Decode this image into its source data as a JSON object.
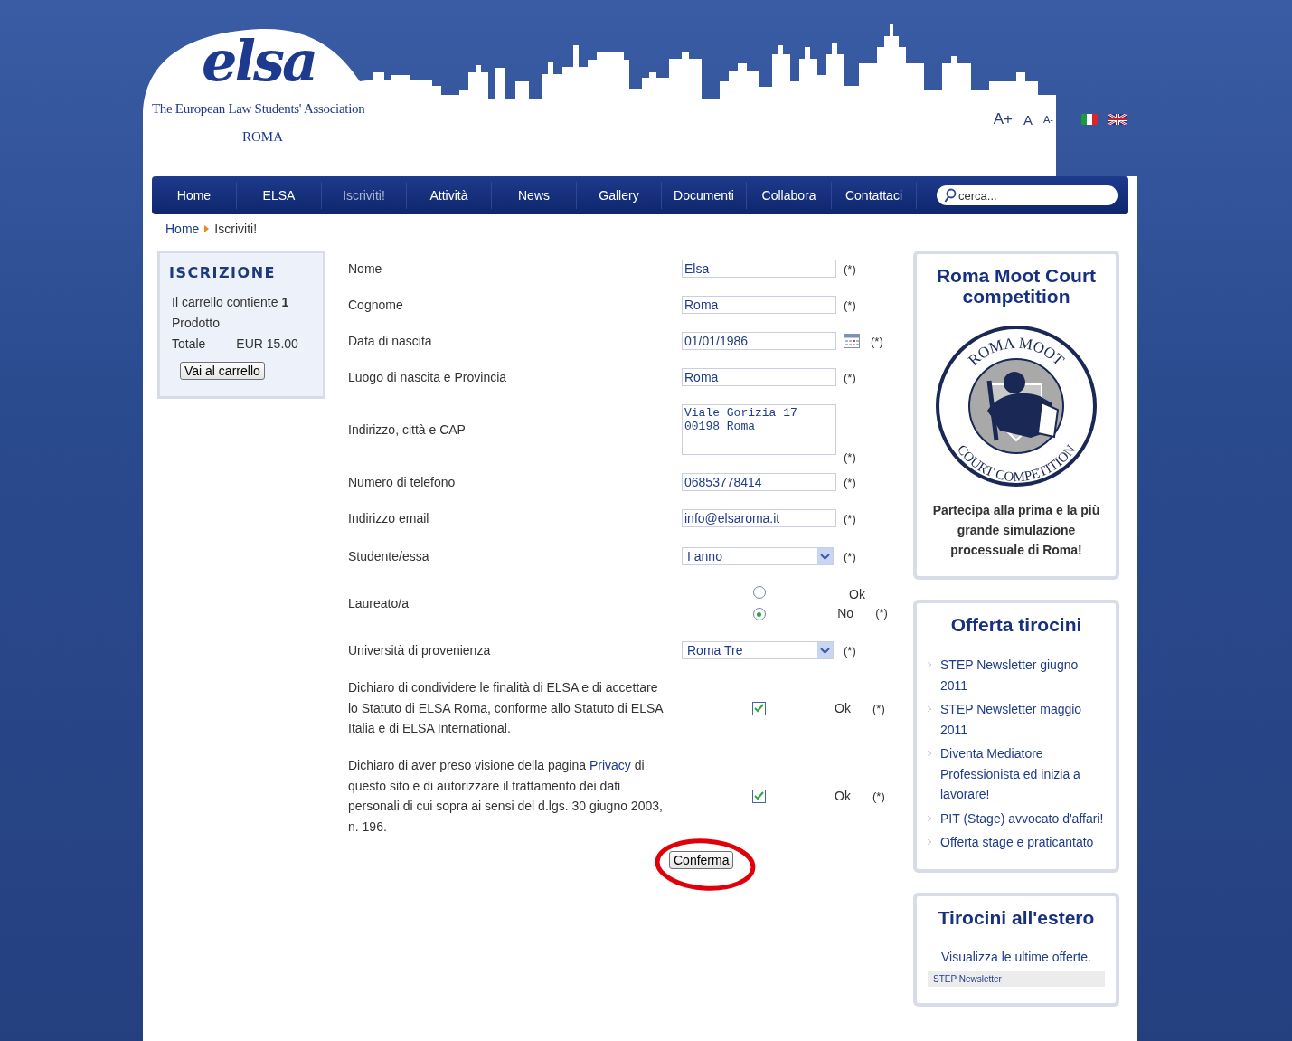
{
  "header": {
    "logo": "elsa",
    "tagline": "The European Law Students' Association",
    "city": "ROMA",
    "font_sizes": [
      "A+",
      "A",
      "A-"
    ]
  },
  "nav": {
    "items": [
      {
        "label": "Home",
        "selected": false
      },
      {
        "label": "ELSA",
        "selected": false
      },
      {
        "label": "Iscriviti!",
        "selected": true
      },
      {
        "label": "Attività",
        "selected": false
      },
      {
        "label": "News",
        "selected": false
      },
      {
        "label": "Gallery",
        "selected": false
      },
      {
        "label": "Documenti",
        "selected": false
      },
      {
        "label": "Collabora",
        "selected": false
      },
      {
        "label": "Contattaci",
        "selected": false
      }
    ],
    "search": {
      "placeholder": "cerca..."
    }
  },
  "breadcrumb": [
    "Home",
    "Iscriviti!"
  ],
  "cart": {
    "title": "ISCRIZIONE",
    "summary": "Il carrello contiente **1** Prodotto",
    "total_label": "Totale",
    "total_value": "EUR 15.00",
    "button": "Vai al carrello"
  },
  "form": {
    "rows": [
      {
        "kind": "text",
        "label": "Nome",
        "value": "Elsa",
        "required": "(*)"
      },
      {
        "kind": "text",
        "label": "Cognome",
        "value": "Roma",
        "required": "(*)"
      },
      {
        "kind": "date",
        "label": "Data di nascita",
        "value": "01/01/1986",
        "required": "(*)"
      },
      {
        "kind": "text",
        "label": "Luogo di nascita e Provincia",
        "value": "Roma",
        "required": "(*)"
      },
      {
        "kind": "textarea",
        "label": "Indirizzo, città e CAP",
        "value": "Viale Gorizia 17\n00198 Roma",
        "required": "(*)"
      },
      {
        "kind": "text",
        "label": "Numero di telefono",
        "value": "06853778414",
        "required": "(*)"
      },
      {
        "kind": "text",
        "label": "Indirizzo email",
        "value": "info@elsaroma.it",
        "required": "(*)"
      },
      {
        "kind": "select",
        "label": "Studente/essa",
        "value": "I anno",
        "required": "(*)"
      },
      {
        "kind": "radio",
        "label": "Laureato/a",
        "options": [
          {
            "label": "Ok",
            "selected": false
          },
          {
            "label": "No",
            "selected": true
          }
        ],
        "required": "(*)"
      },
      {
        "kind": "select",
        "label": "Università di provenienza",
        "value": "Roma Tre",
        "required": "(*)"
      },
      {
        "kind": "checkbox",
        "text_before": "Dichiaro di condividere le finalità di ELSA e di accettare lo Statuto di ELSA Roma, conforme allo Statuto di ELSA Italia e di ELSA International.",
        "checked": true,
        "option": "Ok",
        "required": "(*)"
      },
      {
        "kind": "checkbox",
        "text_before": "Dichiaro di aver preso visione della pagina",
        "link": "Privacy",
        "text_after": "di questo sito e di autorizzare il trattamento dei dati personali di cui sopra ai sensi del d.lgs. 30 giugno 2003, n. 196.",
        "checked": true,
        "option": "Ok",
        "required": "(*)"
      }
    ],
    "submit": "Conferma"
  },
  "sidebar": {
    "moot": {
      "title": "Roma Moot Court competition",
      "seal_top": "ROMA MOOT",
      "seal_bottom": "COURT COMPETITION",
      "text": "Partecipa alla prima e la più grande simulazione processuale di Roma!"
    },
    "internships": {
      "title": "Offerta tirocini",
      "items": [
        "STEP Newsletter giugno 2011",
        "STEP Newsletter maggio 2011",
        "Diventa Mediatore Professionista ed inizia a lavorare!",
        "PIT (Stage) avvocato d'affari!",
        "Offerta stage e praticantato"
      ]
    },
    "abroad": {
      "title": "Tirocini all'estero",
      "text": "Visualizza le ultime offerte.",
      "item": "STEP Newsletter"
    }
  }
}
